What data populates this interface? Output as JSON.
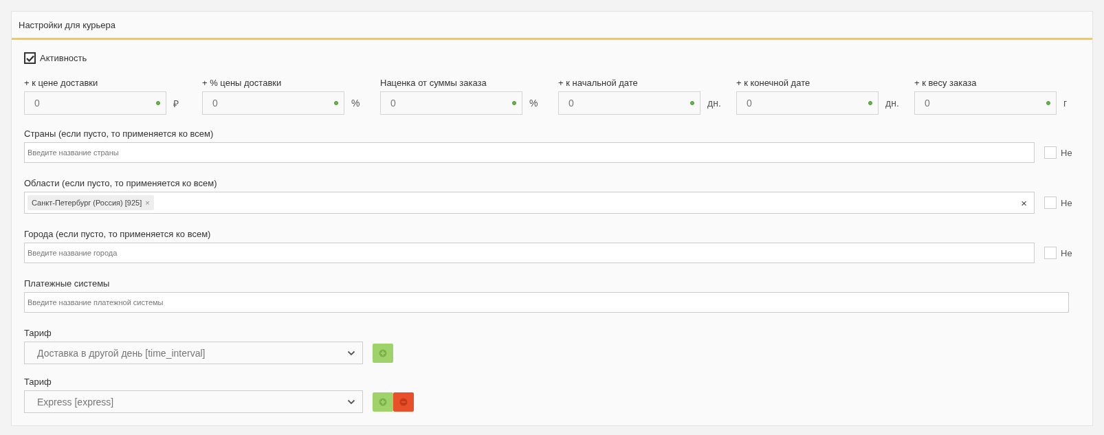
{
  "panel": {
    "title": "Настройки для курьера"
  },
  "active": {
    "label": "Активность",
    "checked": true
  },
  "adjustments": [
    {
      "label": "+ к цене доставки",
      "value": "0",
      "unit": "₽"
    },
    {
      "label": "+ % цены доставки",
      "value": "0",
      "unit": "%"
    },
    {
      "label": "Наценка от суммы заказа",
      "value": "0",
      "unit": "%"
    },
    {
      "label": "+ к начальной дате",
      "value": "0",
      "unit": "дн."
    },
    {
      "label": "+ к конечной дате",
      "value": "0",
      "unit": "дн."
    },
    {
      "label": "+ к весу заказа",
      "value": "0",
      "unit": "г"
    }
  ],
  "filters": [
    {
      "label": "Страны (если пусто, то применяется ко всем)",
      "placeholder": "Введите название страны",
      "negate": {
        "label": "Не",
        "checked": false
      }
    },
    {
      "label": "Области (если пусто, то применяется ко всем)",
      "tags": [
        {
          "text": "Санкт-Петербург (Россия) [925]",
          "remove": "×"
        }
      ],
      "clear": "×",
      "negate": {
        "label": "Не",
        "checked": false
      }
    },
    {
      "label": "Города (если пусто, то применяется ко всем)",
      "placeholder": "Введите название города",
      "negate": {
        "label": "Не",
        "checked": false
      }
    },
    {
      "label": "Платежные системы",
      "placeholder": "Введите название платежной системы"
    }
  ],
  "tariffs": [
    {
      "label": "Тариф",
      "value": "Доставка в другой день [time_interval]",
      "buttons": [
        {
          "kind": "add"
        }
      ]
    },
    {
      "label": "Тариф",
      "value": "Express [express]",
      "buttons": [
        {
          "kind": "add"
        },
        {
          "kind": "remove"
        }
      ]
    }
  ]
}
